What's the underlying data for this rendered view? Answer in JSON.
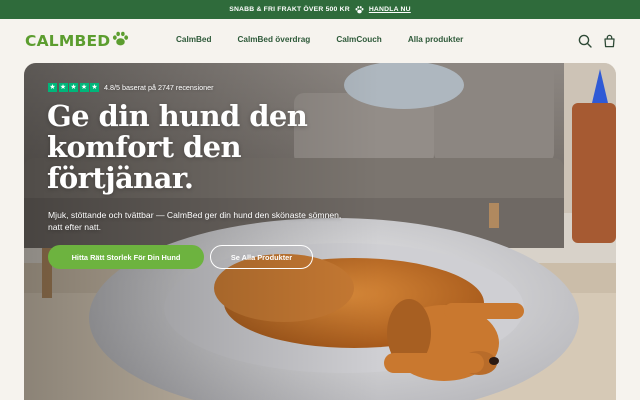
{
  "announcement": {
    "text": "SNABB & FRI FRAKT ÖVER 500 KR",
    "link": "HANDLA NU"
  },
  "header": {
    "logo_text": "CALMBED",
    "logo_icon": "paw-icon",
    "nav": [
      "CalmBed",
      "CalmBed överdrag",
      "CalmCouch",
      "Alla produkter"
    ],
    "icons": [
      "search-icon",
      "cart-icon"
    ]
  },
  "hero": {
    "rating_stars": 5,
    "rating_text": "4.8/5 baserat på 2747 recensioner",
    "headline": "Ge din hund den komfort den förtjänar.",
    "subtext": "Mjuk, stöttande och tvättbar — CalmBed ger din hund den skönaste sömnen, natt efter natt.",
    "primary_button": "Hitta Rätt Storlek För Din Hund",
    "secondary_button": "Se Alla Produkter"
  },
  "colors": {
    "brand_green": "#5c9d2f",
    "announcement_bg": "#2f6b3b",
    "nav_text": "#2f5a3a",
    "button_green": "#6db33f",
    "trustpilot_green": "#00b67a"
  }
}
